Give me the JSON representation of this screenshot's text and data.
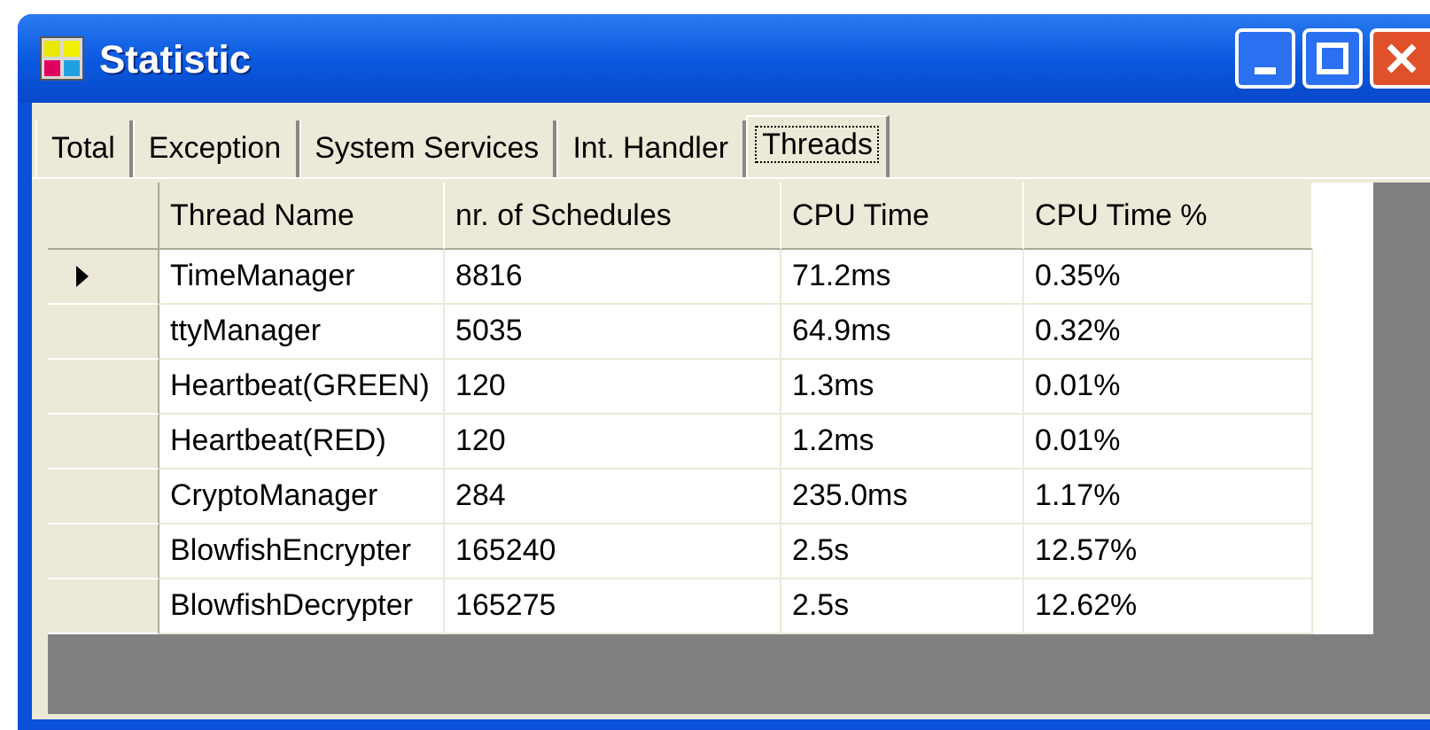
{
  "window": {
    "title": "Statistic"
  },
  "tabs": [
    {
      "label": "Total",
      "selected": false
    },
    {
      "label": "Exception",
      "selected": false
    },
    {
      "label": "System Services",
      "selected": false
    },
    {
      "label": "Int. Handler",
      "selected": false
    },
    {
      "label": "Threads",
      "selected": true
    }
  ],
  "table": {
    "columns": [
      "Thread Name",
      "nr. of Schedules",
      "CPU Time",
      "CPU Time %"
    ],
    "rows": [
      {
        "selected": true,
        "cells": [
          "TimeManager",
          "8816",
          "71.2ms",
          "0.35%"
        ]
      },
      {
        "selected": false,
        "cells": [
          "ttyManager",
          "5035",
          "64.9ms",
          "0.32%"
        ]
      },
      {
        "selected": false,
        "cells": [
          "Heartbeat(GREEN)",
          "120",
          "1.3ms",
          "0.01%"
        ]
      },
      {
        "selected": false,
        "cells": [
          "Heartbeat(RED)",
          "120",
          "1.2ms",
          "0.01%"
        ]
      },
      {
        "selected": false,
        "cells": [
          "CryptoManager",
          "284",
          "235.0ms",
          "1.17%"
        ]
      },
      {
        "selected": false,
        "cells": [
          "BlowfishEncrypter",
          "165240",
          "2.5s",
          "12.57%"
        ]
      },
      {
        "selected": false,
        "cells": [
          "BlowfishDecrypter",
          "165275",
          "2.5s",
          "12.62%"
        ]
      }
    ]
  }
}
